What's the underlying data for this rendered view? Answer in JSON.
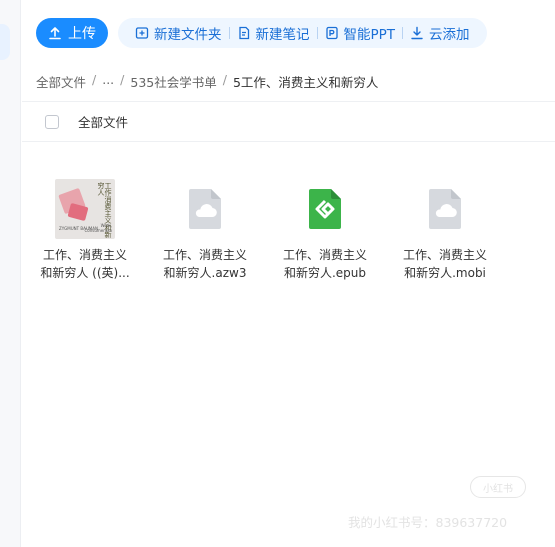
{
  "toolbar": {
    "upload_label": "上传",
    "new_folder_label": "新建文件夹",
    "new_note_label": "新建笔记",
    "smart_ppt_label": "智能PPT",
    "cloud_add_label": "云添加"
  },
  "breadcrumb": {
    "root": "全部文件",
    "ellipsis": "...",
    "parent": "535社会学书单",
    "current": "5工作、消费主义和新穷人"
  },
  "list_header": {
    "select_all_label": "全部文件"
  },
  "files": [
    {
      "name_line1": "工作、消费主义",
      "name_line2": "和新穷人 ((英)...",
      "icon": "book-cover-thumbnail"
    },
    {
      "name_line1": "工作、消费主义",
      "name_line2": "和新穷人.azw3",
      "icon": "cloud-file-icon"
    },
    {
      "name_line1": "工作、消费主义",
      "name_line2": "和新穷人.epub",
      "icon": "epub-file-icon"
    },
    {
      "name_line1": "工作、消费主义",
      "name_line2": "和新穷人.mobi",
      "icon": "cloud-file-icon"
    }
  ],
  "cover": {
    "title": "工作消费主义和新穷人",
    "author": "ZYGMUNT BAUMAN",
    "subtitle_line1": "Work,",
    "subtitle_line2": "Consumerism"
  },
  "watermark": {
    "badge": "小红书",
    "text": "我的小红书号：839637720"
  },
  "colors": {
    "accent": "#1a8cff",
    "toolbar_bg": "#eef6ff",
    "epub_green": "#3cb44a"
  }
}
